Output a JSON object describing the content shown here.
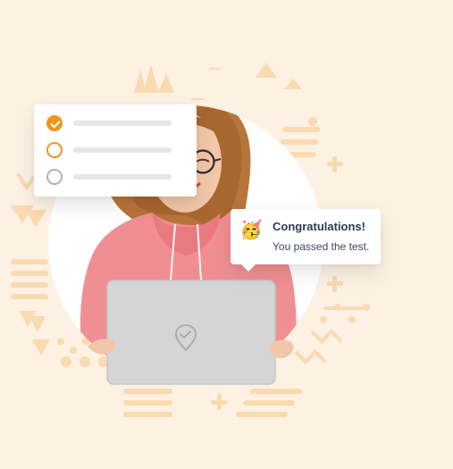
{
  "toast": {
    "title": "Congratulations!",
    "message": "You passed the test.",
    "icon": "party-popper-icon"
  },
  "checklist": {
    "items": [
      {
        "state": "checked",
        "color": "#F0951D"
      },
      {
        "state": "unchecked",
        "color": "#F0951D"
      },
      {
        "state": "unchecked",
        "color": "#AAB2BE"
      }
    ]
  },
  "colors": {
    "background": "#FDF1E3",
    "pattern": "#F9D9AF",
    "accent": "#F0951D",
    "hoodie": "#F08F93",
    "laptop": "#CFCFCF"
  }
}
